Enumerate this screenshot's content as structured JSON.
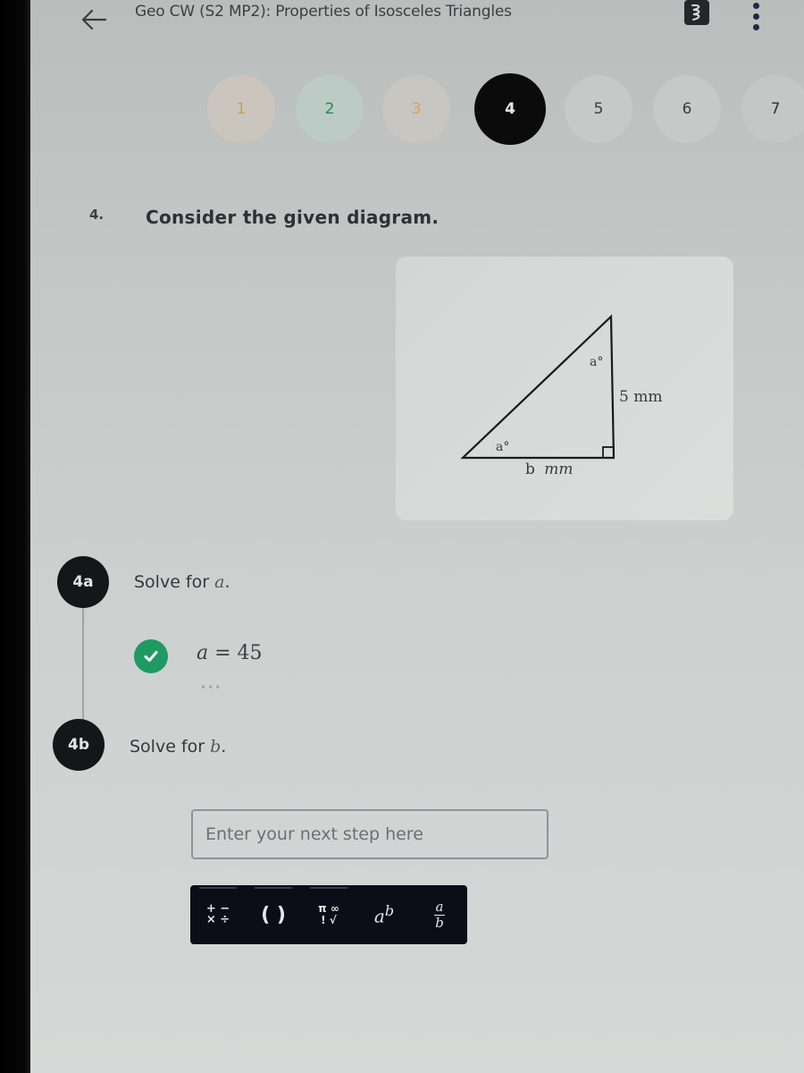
{
  "header": {
    "title": "Geo CW (S2 MP2): Properties of Isosceles Triangles",
    "back_icon": "arrow-left-icon",
    "app_icon": "app-badge-icon",
    "more_icon": "more-vertical-icon"
  },
  "steps": [
    {
      "label": "1",
      "status": "attempted",
      "color": "#d19a55"
    },
    {
      "label": "2",
      "status": "correct",
      "color": "#1f8a5a"
    },
    {
      "label": "3",
      "status": "attempted",
      "color": "#d7a45a"
    },
    {
      "label": "4",
      "status": "current",
      "color": "#0b0b0c"
    },
    {
      "label": "5",
      "status": "unvisited"
    },
    {
      "label": "6",
      "status": "unvisited"
    },
    {
      "label": "7",
      "status": "unvisited"
    }
  ],
  "problem": {
    "number": "4.",
    "text": "Consider the given diagram.",
    "diagram": {
      "angle_top": "a°",
      "angle_bottom_left": "a°",
      "vertical_side": "5 mm",
      "base_value": "b",
      "base_unit": "mm",
      "right_angle": true
    }
  },
  "parts": [
    {
      "badge": "4a",
      "prompt_prefix": "Solve for",
      "variable": "a",
      "prompt_suffix": ".",
      "answer_var": "a",
      "answer_rest": " = 45",
      "status": "correct",
      "more": "•••"
    },
    {
      "badge": "4b",
      "prompt_prefix": "Solve for",
      "variable": "b",
      "prompt_suffix": ".",
      "input_placeholder": "Enter your next step here",
      "input_value": ""
    }
  ],
  "math_toolbar": {
    "keys": [
      {
        "name": "operators",
        "line1": "+ −",
        "line2": "× ÷"
      },
      {
        "name": "parentheses",
        "label": "( )"
      },
      {
        "name": "symbols",
        "line1": "π ∞",
        "line2": "! √"
      },
      {
        "name": "exponent",
        "base": "a",
        "exp": "b"
      },
      {
        "name": "fraction",
        "num": "a",
        "den": "b"
      }
    ]
  },
  "colors": {
    "correct": "#1e9a62",
    "current_step": "#0b0b0c",
    "toolbar_bg": "#0b0e18"
  }
}
